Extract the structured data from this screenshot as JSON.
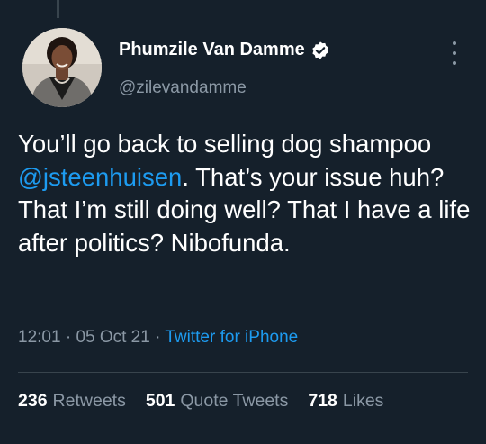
{
  "author": {
    "display_name": "Phumzile Van Damme",
    "handle": "@zilevandamme",
    "verified": true,
    "avatar_icon": "profile-photo"
  },
  "tweet": {
    "text_before": "You’ll go back to selling dog shampoo ",
    "mention": "@jsteenhuisen",
    "text_after": ". That’s your issue huh? That I’m still doing well? That I have a life after politics? Nibofunda."
  },
  "meta": {
    "time": "12:01",
    "separator": "·",
    "date": "05 Oct 21",
    "source": "Twitter for iPhone"
  },
  "stats": {
    "retweets_count": "236",
    "retweets_label": "Retweets",
    "quotes_count": "501",
    "quotes_label": "Quote Tweets",
    "likes_count": "718",
    "likes_label": "Likes"
  },
  "colors": {
    "background": "#15202b",
    "accent": "#1d9bf0",
    "secondary_text": "#8b98a5"
  }
}
